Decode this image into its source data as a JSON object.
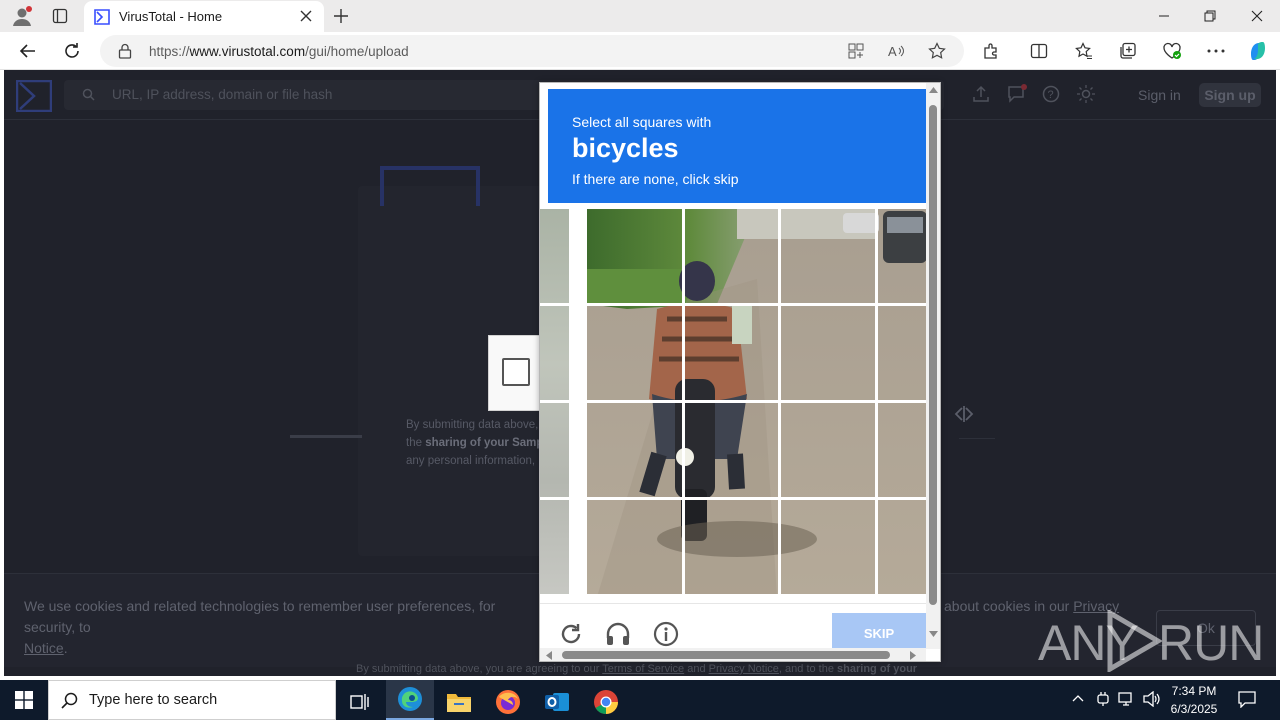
{
  "browser": {
    "tab_title": "VirusTotal - Home",
    "url_prefix": "https://",
    "url_host": "www.virustotal.com",
    "url_path": "/gui/home/upload"
  },
  "virustotal": {
    "search_placeholder": "URL, IP address, domain or file hash",
    "signin_label": "Sign in",
    "signup_label": "Sign up",
    "terms_line1": "By submitting data above,",
    "terms_line2_prefix": "the ",
    "terms_line2_bold": "sharing of your Samp",
    "terms_line3": "any personal information,",
    "cookie_text_left_1": "We use cookies and related technologies to remember user preferences, for security, to",
    "cookie_text_left_2": "Notice",
    "cookie_text_right": "about cookies in our",
    "cookie_link": "Privacy",
    "ok_label": "Ok",
    "footer_prefix": "By submitting data above, you are agreeing to our ",
    "footer_tos": "Terms of Service",
    "footer_and": " and ",
    "footer_privacy": "Privacy Notice",
    "footer_suffix": ", and to the ",
    "footer_bold": "sharing of your"
  },
  "captcha": {
    "instruction": "Select all squares with",
    "object": "bicycles",
    "note": "If there are none, click skip",
    "skip_label": "SKIP",
    "grid_size": "4x4",
    "accent_color": "#1a73e8"
  },
  "watermark": {
    "left": "ANY",
    "right": "RUN"
  },
  "taskbar": {
    "search_placeholder": "Type here to search",
    "time": "7:34 PM",
    "date": "6/3/2025"
  }
}
